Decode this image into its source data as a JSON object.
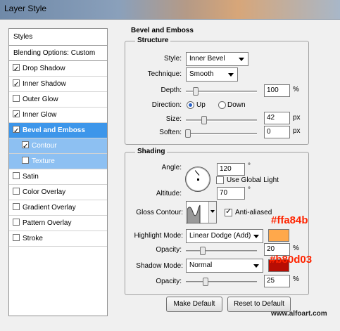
{
  "window": {
    "title": "Layer Style"
  },
  "left_list": {
    "header": "Styles",
    "blending_options": "Blending Options: Custom",
    "items": [
      {
        "label": "Drop Shadow",
        "checked": true
      },
      {
        "label": "Inner Shadow",
        "checked": true
      },
      {
        "label": "Outer Glow",
        "checked": false
      },
      {
        "label": "Inner Glow",
        "checked": true
      },
      {
        "label": "Bevel and Emboss",
        "checked": true,
        "selected": true
      },
      {
        "label": "Contour",
        "checked": true,
        "sub": true
      },
      {
        "label": "Texture",
        "checked": false,
        "sub": true
      },
      {
        "label": "Satin",
        "checked": false
      },
      {
        "label": "Color Overlay",
        "checked": false
      },
      {
        "label": "Gradient Overlay",
        "checked": false
      },
      {
        "label": "Pattern Overlay",
        "checked": false
      },
      {
        "label": "Stroke",
        "checked": false
      }
    ]
  },
  "panel": {
    "title": "Bevel and Emboss",
    "structure": {
      "label": "Structure",
      "style_label": "Style:",
      "style_value": "Inner Bevel",
      "technique_label": "Technique:",
      "technique_value": "Smooth",
      "depth_label": "Depth:",
      "depth_value": "100",
      "depth_unit": "%",
      "direction_label": "Direction:",
      "direction_up": "Up",
      "direction_down": "Down",
      "size_label": "Size:",
      "size_value": "42",
      "size_unit": "px",
      "soften_label": "Soften:",
      "soften_value": "0",
      "soften_unit": "px"
    },
    "shading": {
      "label": "Shading",
      "angle_label": "Angle:",
      "angle_value": "120",
      "angle_unit": "°",
      "global_light_label": "Use Global Light",
      "altitude_label": "Altitude:",
      "altitude_value": "70",
      "altitude_unit": "°",
      "gloss_label": "Gloss Contour:",
      "anti_aliased_label": "Anti-aliased",
      "highlight_label": "Highlight Mode:",
      "highlight_value": "Linear Dodge (Add)",
      "highlight_opacity_label": "Opacity:",
      "highlight_opacity_value": "20",
      "shadow_label": "Shadow Mode:",
      "shadow_value": "Normal",
      "shadow_opacity_label": "Opacity:",
      "shadow_opacity_value": "25",
      "percent": "%"
    },
    "buttons": {
      "make_default": "Make Default",
      "reset_default": "Reset to Default"
    }
  },
  "annotations": {
    "highlight_color_text": "#ffa84b",
    "shadow_color_text": "#b80d03",
    "watermark": "www.alfoart.com"
  },
  "colors": {
    "highlight": "#ffa84b",
    "shadow": "#b80d03",
    "selection": "#3d96ea",
    "sub_selection": "#8dc0f2"
  }
}
